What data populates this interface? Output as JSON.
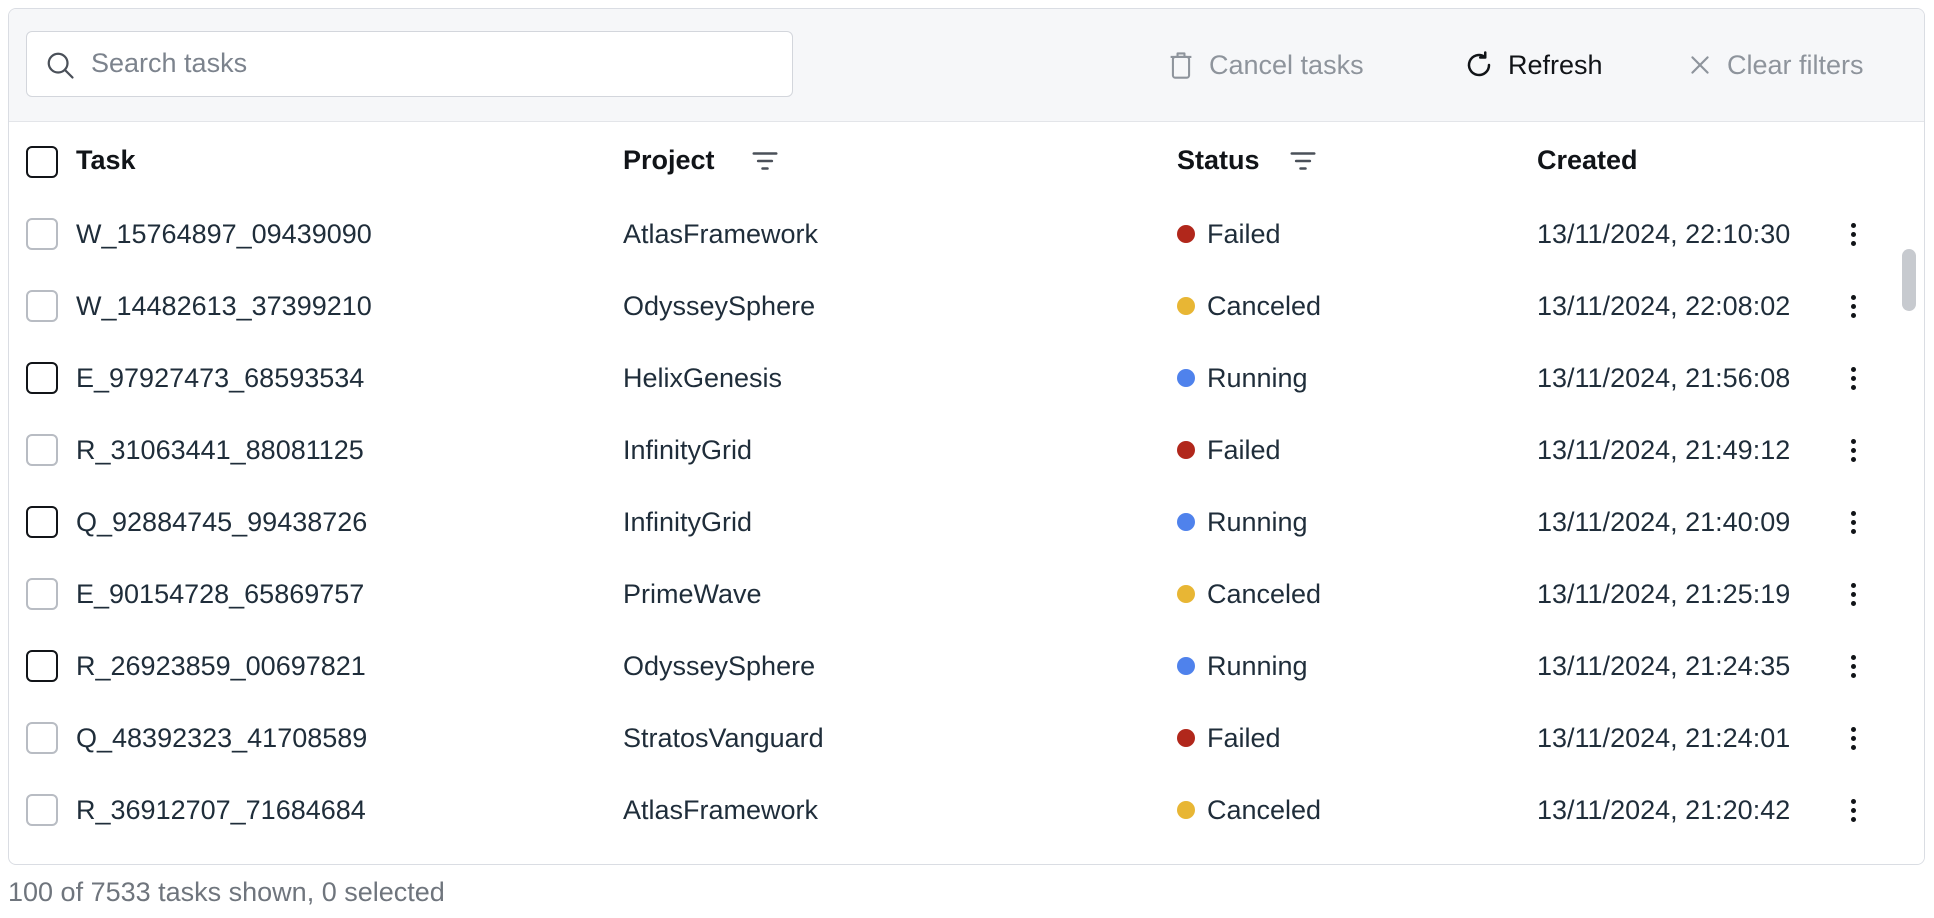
{
  "toolbar": {
    "search_placeholder": "Search tasks",
    "cancel_label": "Cancel tasks",
    "refresh_label": "Refresh",
    "clear_label": "Clear filters"
  },
  "columns": {
    "task": "Task",
    "project": "Project",
    "status": "Status",
    "created": "Created"
  },
  "status_colors": {
    "Failed": "#b1271b",
    "Canceled": "#e8b634",
    "Running": "#4f82ec"
  },
  "rows": [
    {
      "task": "W_15764897_09439090",
      "project": "AtlasFramework",
      "status": "Failed",
      "created": "13/11/2024, 22:10:30"
    },
    {
      "task": "W_14482613_37399210",
      "project": "OdysseySphere",
      "status": "Canceled",
      "created": "13/11/2024, 22:08:02"
    },
    {
      "task": "E_97927473_68593534",
      "project": "HelixGenesis",
      "status": "Running",
      "created": "13/11/2024, 21:56:08"
    },
    {
      "task": "R_31063441_88081125",
      "project": "InfinityGrid",
      "status": "Failed",
      "created": "13/11/2024, 21:49:12"
    },
    {
      "task": "Q_92884745_99438726",
      "project": "InfinityGrid",
      "status": "Running",
      "created": "13/11/2024, 21:40:09"
    },
    {
      "task": "E_90154728_65869757",
      "project": "PrimeWave",
      "status": "Canceled",
      "created": "13/11/2024, 21:25:19"
    },
    {
      "task": "R_26923859_00697821",
      "project": "OdysseySphere",
      "status": "Running",
      "created": "13/11/2024, 21:24:35"
    },
    {
      "task": "Q_48392323_41708589",
      "project": "StratosVanguard",
      "status": "Failed",
      "created": "13/11/2024, 21:24:01"
    },
    {
      "task": "R_36912707_71684684",
      "project": "AtlasFramework",
      "status": "Canceled",
      "created": "13/11/2024, 21:20:42"
    }
  ],
  "footer": {
    "summary": "100 of 7533 tasks shown, 0 selected"
  }
}
